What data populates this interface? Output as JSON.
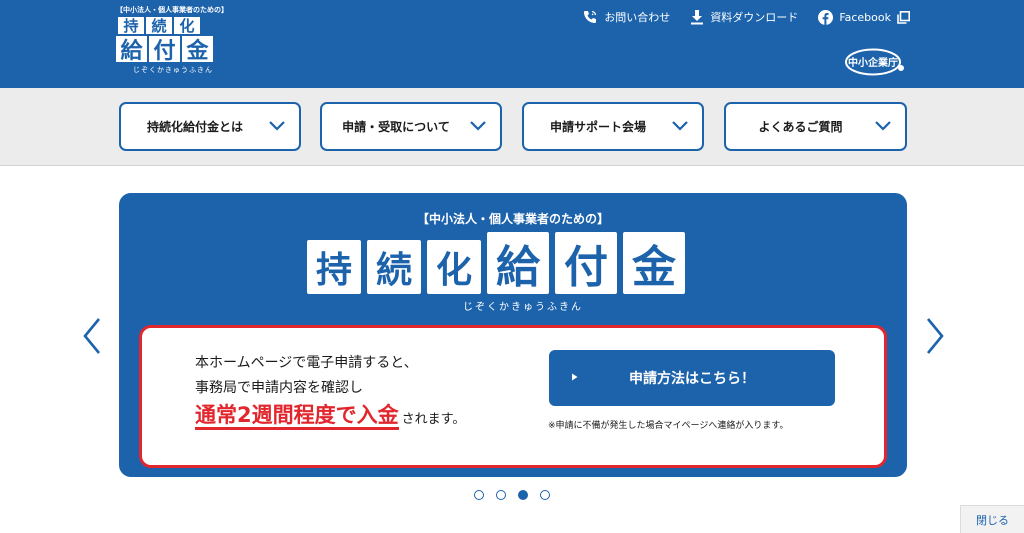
{
  "logo": {
    "tagline": "【中小法人・個人事業者のための】",
    "row1": [
      "持",
      "続",
      "化"
    ],
    "row2": [
      "給",
      "付",
      "金"
    ],
    "ruby": "じぞくかきゅうふきん"
  },
  "header": {
    "links": [
      {
        "label": "お問い合わせ",
        "icon": "phone-icon"
      },
      {
        "label": "資料ダウンロード",
        "icon": "download-icon"
      },
      {
        "label": "Facebook",
        "icon": "facebook-icon"
      }
    ],
    "agency_label": "中小企業庁"
  },
  "nav": {
    "items": [
      {
        "label": "持続化給付金とは"
      },
      {
        "label": "申請・受取について"
      },
      {
        "label": "申請サポート会場"
      },
      {
        "label": "よくあるご質問"
      }
    ]
  },
  "hero": {
    "tagline": "【中小法人・個人事業者のための】",
    "title_small": [
      "持",
      "続",
      "化"
    ],
    "title_big": [
      "給",
      "付",
      "金"
    ],
    "ruby": "じぞくかきゅうふきん",
    "line1": "本ホームページで電子申請すると、",
    "line2": "事務局で申請内容を確認し",
    "highlight": "通常2週間程度で入金",
    "highlight_suffix": "されます。",
    "button_label": "申請方法はこちら！",
    "note": "※申請に不備が発生した場合マイページへ連絡が入ります。"
  },
  "carousel": {
    "dots": [
      false,
      false,
      true,
      false
    ]
  },
  "footer": {
    "close_label": "閉じる"
  },
  "colors": {
    "brand_blue": "#1c63ac",
    "accent_red": "#e1272d",
    "nav_bg": "#ececec"
  }
}
